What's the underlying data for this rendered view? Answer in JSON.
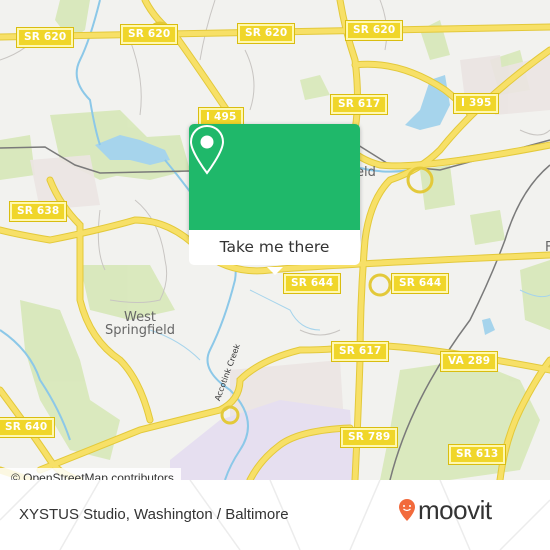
{
  "map": {
    "road_shields": [
      {
        "label": "SR 620"
      },
      {
        "label": "SR 620"
      },
      {
        "label": "SR 620"
      },
      {
        "label": "SR 620"
      },
      {
        "label": "I 495"
      },
      {
        "label": "SR 617"
      },
      {
        "label": "I 395"
      },
      {
        "label": "SR 638"
      },
      {
        "label": "SR 644"
      },
      {
        "label": "SR 644"
      },
      {
        "label": "SR 617"
      },
      {
        "label": "VA 289"
      },
      {
        "label": "SR 640"
      },
      {
        "label": "SR 789"
      },
      {
        "label": "SR 613"
      }
    ],
    "place_labels": {
      "west_springfield": "West\nSpringfield",
      "springfield_partial": "eld",
      "accotink_creek": "Accotink Creek",
      "right_edge_partial": "F"
    },
    "colors": {
      "background": "#f2f2ef",
      "road": "#f5dc50",
      "water": "#a6d4ec",
      "park": "#d7e8b8",
      "accent_green": "#1fb86a"
    }
  },
  "popup": {
    "pin_icon": "map-pin-icon",
    "button_label": "Take me there"
  },
  "attribution": "© OpenStreetMap contributors",
  "footer": {
    "title": "XYSTUS Studio, Washington / Baltimore",
    "logo_text": "moovit",
    "logo_color": "#f26a3c"
  }
}
